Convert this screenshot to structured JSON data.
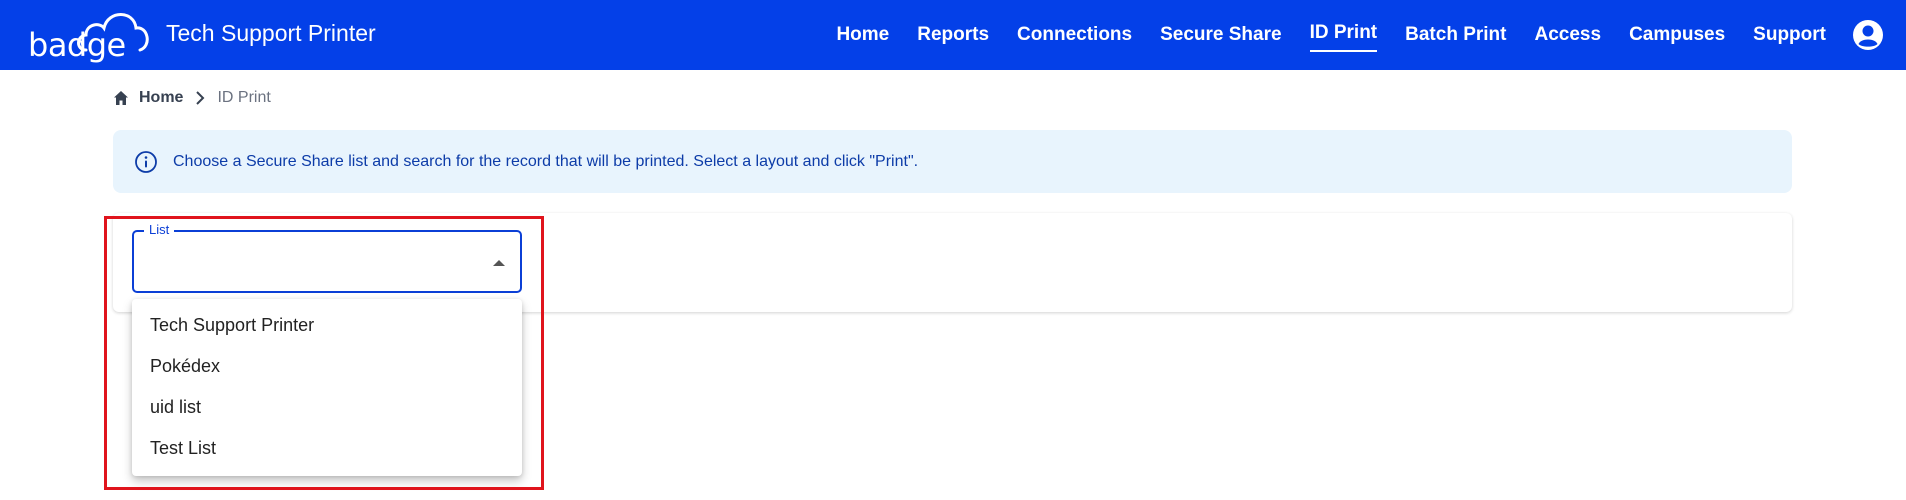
{
  "header": {
    "logo_text": "badge",
    "app_title": "Tech Support Printer",
    "nav": [
      {
        "label": "Home"
      },
      {
        "label": "Reports"
      },
      {
        "label": "Connections"
      },
      {
        "label": "Secure Share"
      },
      {
        "label": "ID Print",
        "active": true
      },
      {
        "label": "Batch Print"
      },
      {
        "label": "Access"
      },
      {
        "label": "Campuses"
      },
      {
        "label": "Support"
      }
    ],
    "account_icon": "user-circle-icon"
  },
  "breadcrumb": {
    "home_icon": "home-icon",
    "home": "Home",
    "separator_icon": "chevron-right-icon",
    "current": "ID Print"
  },
  "info": {
    "icon": "info-icon",
    "text": "Choose a Secure Share list and search for the record that will be printed. Select a layout and click \"Print\"."
  },
  "list_select": {
    "label": "List",
    "value": "",
    "arrow_icon": "caret-up-icon",
    "options": [
      "Tech Support Printer",
      "Pokédex",
      "uid list",
      "Test List"
    ]
  },
  "colors": {
    "brand": "#0440e8",
    "info_bg": "#e8f4fd",
    "info_text": "#0d3ca8",
    "focus": "#0b3fd6",
    "highlight": "#e0141c"
  }
}
